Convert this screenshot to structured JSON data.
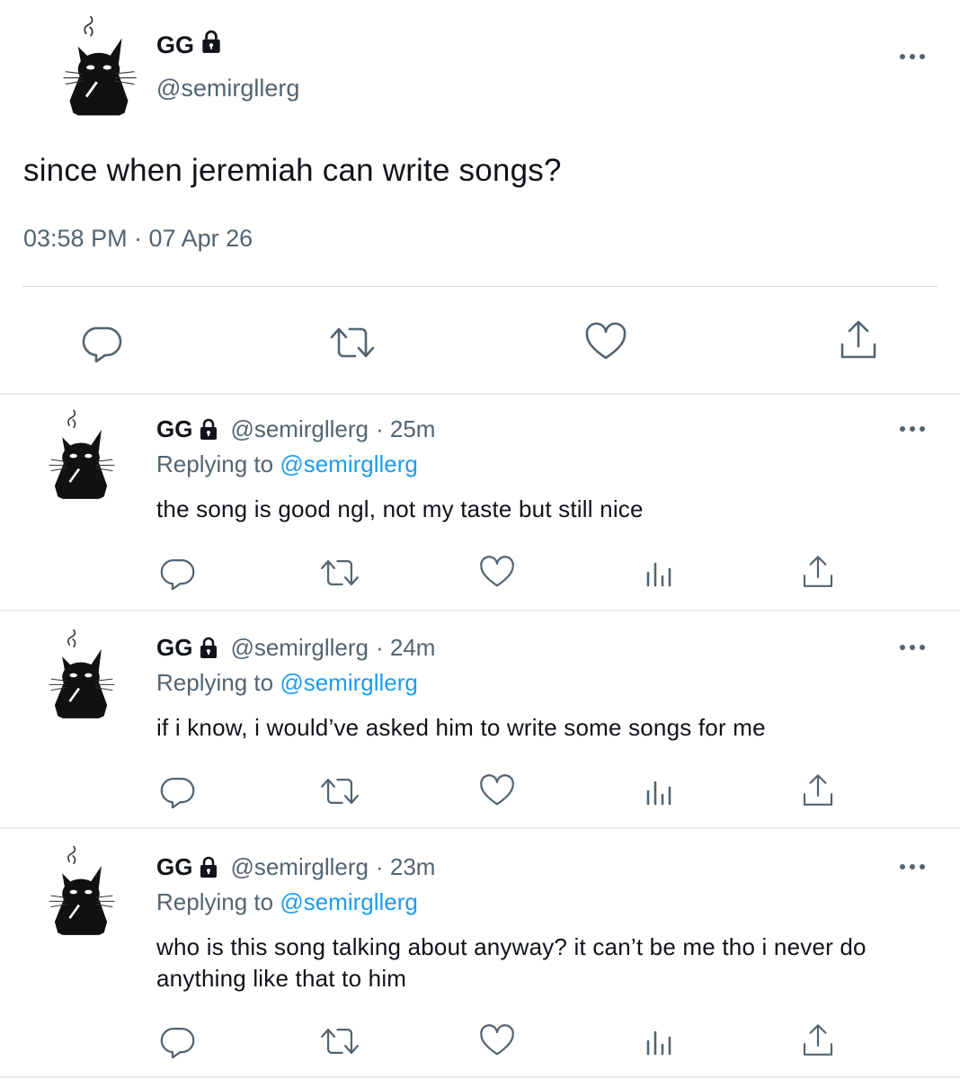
{
  "main_tweet": {
    "display_name": "GG",
    "handle": "@semirgllerg",
    "text": "since when jeremiah can write songs?",
    "timestamp": "03:58 PM · 07 Apr 26"
  },
  "replies": [
    {
      "display_name": "GG",
      "handle": "@semirgllerg",
      "time_ago": "· 25m",
      "replying_prefix": "Replying to",
      "replying_to": "@semirgllerg",
      "text": "the song is good ngl, not my taste but still nice"
    },
    {
      "display_name": "GG",
      "handle": "@semirgllerg",
      "time_ago": "· 24m",
      "replying_prefix": "Replying to",
      "replying_to": "@semirgllerg",
      "text": "if i know, i would’ve asked him to write some songs for me"
    },
    {
      "display_name": "GG",
      "handle": "@semirgllerg",
      "time_ago": "· 23m",
      "replying_prefix": "Replying to",
      "replying_to": "@semirgllerg",
      "text": "who is this song talking about anyway? it can’t be me tho i never do anything like that to him"
    }
  ],
  "icons": {
    "lock": "lock-icon",
    "more": "more-icon",
    "reply": "reply-icon",
    "retweet": "retweet-icon",
    "like": "like-icon",
    "views": "views-icon",
    "share": "share-icon",
    "avatar": "cat-avatar"
  },
  "colors": {
    "text": "#0f1419",
    "muted": "#536471",
    "link": "#1d9bf0",
    "divider": "#cfd9de"
  }
}
